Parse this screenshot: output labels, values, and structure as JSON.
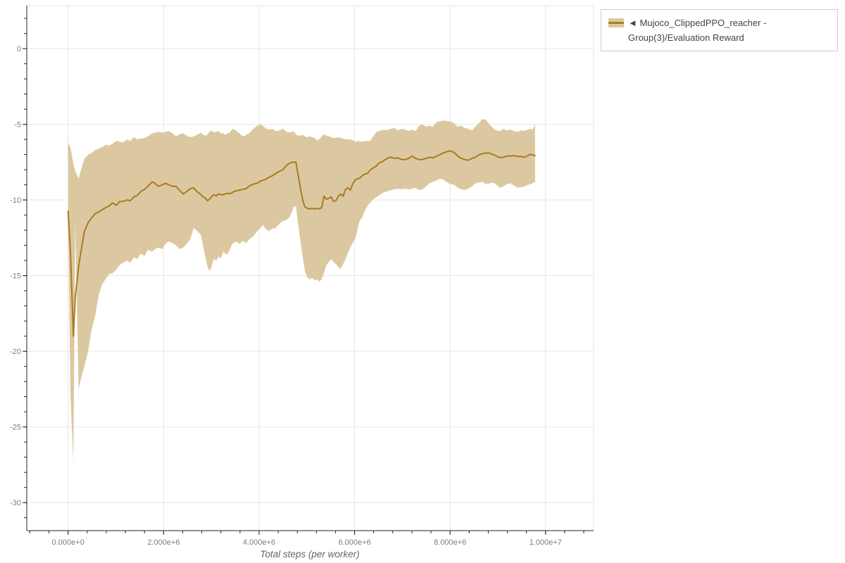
{
  "colors": {
    "background": "#ffffff",
    "line": "#a87b21",
    "band": "#dcc8a0",
    "grid": "#e5e5e5",
    "plot_outline": "#e5e5e5",
    "axis": "#262626",
    "tick_label": "#7d7d7d",
    "axis_title": "#666666",
    "legend_border": "#cccccc",
    "legend_text": "#444444"
  },
  "legend": {
    "items": [
      {
        "label": "◄ Mujoco_ClippedPPO_reacher - Group(3)/Evaluation Reward",
        "lines": [
          "◄ Mujoco_ClippedPPO_reacher - Group(3)/Evaluation",
          "Reward"
        ],
        "swatch_band_color": "#dcc8a0",
        "swatch_line_color": "#a87b21"
      }
    ]
  },
  "chart_data": {
    "type": "line",
    "title": "",
    "xlabel": "Total steps (per worker)",
    "ylabel": "",
    "grid": true,
    "legend_position": "top-right",
    "x_axis": {
      "min": -866000,
      "max": 11006000,
      "major_ticks": [
        {
          "value": 0,
          "label": "0.000e+0"
        },
        {
          "value": 2000000,
          "label": "2.000e+6"
        },
        {
          "value": 4000000,
          "label": "4.000e+6"
        },
        {
          "value": 6000000,
          "label": "6.000e+6"
        },
        {
          "value": 8000000,
          "label": "8.000e+6"
        },
        {
          "value": 10000000,
          "label": "1.000e+7"
        }
      ],
      "minor_tick_step": 400000
    },
    "y_axis": {
      "min": -31.85,
      "max": 2.84,
      "major_ticks": [
        {
          "value": 0,
          "label": "0"
        },
        {
          "value": -5,
          "label": "-5"
        },
        {
          "value": -10,
          "label": "-10"
        },
        {
          "value": -15,
          "label": "-15"
        },
        {
          "value": -20,
          "label": "-20"
        },
        {
          "value": -25,
          "label": "-25"
        },
        {
          "value": -30,
          "label": "-30"
        }
      ],
      "minor_tick_step": 1
    },
    "series": [
      {
        "name": "◄ Mujoco_ClippedPPO_reacher - Group(3)/Evaluation Reward",
        "line_color": "#a87b21",
        "band_color": "#dcc8a0",
        "point_format": [
          "x_steps",
          "mean",
          "band_low",
          "band_high"
        ],
        "points": [
          [
            0,
            -10.74,
            -11.0,
            -6.2
          ],
          [
            50000,
            -13.5,
            -23.0,
            -6.55
          ],
          [
            110000,
            -19.0,
            -27.3,
            -7.6
          ],
          [
            150000,
            -16.4,
            -11.5,
            -8.1
          ],
          [
            220000,
            -14.4,
            -22.5,
            -8.6
          ],
          [
            270000,
            -13.4,
            -21.8,
            -8.0
          ],
          [
            340000,
            -12.1,
            -21.0,
            -7.3
          ],
          [
            420000,
            -11.5,
            -20.0,
            -7.0
          ],
          [
            490000,
            -11.2,
            -18.6,
            -6.9
          ],
          [
            570000,
            -10.9,
            -17.6,
            -6.7
          ],
          [
            640000,
            -10.8,
            -16.3,
            -6.6
          ],
          [
            710000,
            -10.65,
            -15.6,
            -6.5
          ],
          [
            790000,
            -10.5,
            -15.2,
            -6.35
          ],
          [
            860000,
            -10.4,
            -14.9,
            -6.4
          ],
          [
            930000,
            -10.2,
            -14.85,
            -6.3
          ],
          [
            1010000,
            -10.35,
            -14.6,
            -6.1
          ],
          [
            1080000,
            -10.1,
            -14.3,
            -6.15
          ],
          [
            1150000,
            -10.1,
            -14.15,
            -6.2
          ],
          [
            1230000,
            -10.0,
            -14.0,
            -6.0
          ],
          [
            1300000,
            -10.05,
            -14.15,
            -6.1
          ],
          [
            1380000,
            -9.8,
            -13.8,
            -5.85
          ],
          [
            1450000,
            -9.7,
            -13.9,
            -6.0
          ],
          [
            1520000,
            -9.45,
            -13.55,
            -5.95
          ],
          [
            1600000,
            -9.3,
            -13.7,
            -5.9
          ],
          [
            1670000,
            -9.1,
            -13.3,
            -5.8
          ],
          [
            1760000,
            -8.8,
            -13.4,
            -5.6
          ],
          [
            1820000,
            -8.9,
            -13.25,
            -5.55
          ],
          [
            1890000,
            -9.1,
            -13.15,
            -5.5
          ],
          [
            1970000,
            -9.0,
            -13.25,
            -5.55
          ],
          [
            2040000,
            -8.9,
            -12.9,
            -5.5
          ],
          [
            2110000,
            -9.0,
            -12.75,
            -5.45
          ],
          [
            2190000,
            -9.1,
            -12.85,
            -5.6
          ],
          [
            2260000,
            -9.1,
            -13.0,
            -5.8
          ],
          [
            2330000,
            -9.35,
            -13.25,
            -5.65
          ],
          [
            2410000,
            -9.6,
            -13.15,
            -5.6
          ],
          [
            2480000,
            -9.45,
            -12.9,
            -5.75
          ],
          [
            2560000,
            -9.25,
            -12.6,
            -5.85
          ],
          [
            2630000,
            -9.2,
            -11.85,
            -5.8
          ],
          [
            2700000,
            -9.45,
            -12.05,
            -5.7
          ],
          [
            2780000,
            -9.65,
            -12.3,
            -5.55
          ],
          [
            2830000,
            -9.8,
            -13.1,
            -5.7
          ],
          [
            2880000,
            -9.9,
            -13.8,
            -5.75
          ],
          [
            2920000,
            -10.05,
            -14.4,
            -5.65
          ],
          [
            2960000,
            -9.95,
            -14.7,
            -5.5
          ],
          [
            3000000,
            -9.8,
            -14.45,
            -5.4
          ],
          [
            3050000,
            -9.65,
            -13.9,
            -5.55
          ],
          [
            3100000,
            -9.75,
            -14.0,
            -5.5
          ],
          [
            3150000,
            -9.6,
            -13.75,
            -5.45
          ],
          [
            3200000,
            -9.65,
            -13.85,
            -5.6
          ],
          [
            3250000,
            -9.65,
            -13.4,
            -5.6
          ],
          [
            3290000,
            -9.6,
            -13.55,
            -5.7
          ],
          [
            3340000,
            -9.55,
            -13.6,
            -5.6
          ],
          [
            3390000,
            -9.6,
            -13.25,
            -5.55
          ],
          [
            3440000,
            -9.5,
            -12.9,
            -5.3
          ],
          [
            3510000,
            -9.4,
            -12.75,
            -5.4
          ],
          [
            3590000,
            -9.35,
            -12.9,
            -5.6
          ],
          [
            3660000,
            -9.3,
            -12.7,
            -5.8
          ],
          [
            3730000,
            -9.25,
            -12.85,
            -5.7
          ],
          [
            3810000,
            -9.05,
            -12.55,
            -5.55
          ],
          [
            3880000,
            -8.95,
            -12.4,
            -5.3
          ],
          [
            3960000,
            -8.9,
            -12.05,
            -5.1
          ],
          [
            4030000,
            -8.75,
            -11.85,
            -5.0
          ],
          [
            4080000,
            -8.7,
            -11.65,
            -5.1
          ],
          [
            4130000,
            -8.65,
            -11.9,
            -5.25
          ],
          [
            4210000,
            -8.5,
            -12.05,
            -5.35
          ],
          [
            4280000,
            -8.4,
            -11.9,
            -5.3
          ],
          [
            4350000,
            -8.25,
            -11.85,
            -5.45
          ],
          [
            4430000,
            -8.1,
            -11.55,
            -5.4
          ],
          [
            4500000,
            -8.0,
            -11.4,
            -5.3
          ],
          [
            4580000,
            -7.7,
            -11.3,
            -5.5
          ],
          [
            4650000,
            -7.55,
            -11.1,
            -5.55
          ],
          [
            4720000,
            -7.5,
            -10.5,
            -5.45
          ],
          [
            4770000,
            -7.5,
            -10.4,
            -5.65
          ],
          [
            4820000,
            -8.4,
            -11.7,
            -5.75
          ],
          [
            4870000,
            -9.3,
            -12.8,
            -5.75
          ],
          [
            4920000,
            -10.1,
            -13.9,
            -5.7
          ],
          [
            4960000,
            -10.45,
            -14.7,
            -5.8
          ],
          [
            5010000,
            -10.55,
            -15.1,
            -5.85
          ],
          [
            5060000,
            -10.6,
            -15.25,
            -5.8
          ],
          [
            5110000,
            -10.55,
            -15.15,
            -5.85
          ],
          [
            5160000,
            -10.6,
            -15.3,
            -5.9
          ],
          [
            5210000,
            -10.55,
            -15.25,
            -6.05
          ],
          [
            5260000,
            -10.6,
            -15.4,
            -6.0
          ],
          [
            5310000,
            -10.5,
            -15.25,
            -5.8
          ],
          [
            5360000,
            -9.75,
            -14.8,
            -5.65
          ],
          [
            5410000,
            -9.95,
            -14.3,
            -5.75
          ],
          [
            5460000,
            -9.9,
            -14.1,
            -5.8
          ],
          [
            5510000,
            -9.8,
            -13.9,
            -5.85
          ],
          [
            5560000,
            -10.1,
            -14.1,
            -5.9
          ],
          [
            5610000,
            -10.05,
            -14.25,
            -5.9
          ],
          [
            5660000,
            -9.75,
            -14.45,
            -5.85
          ],
          [
            5710000,
            -9.6,
            -14.55,
            -5.9
          ],
          [
            5760000,
            -9.75,
            -14.25,
            -5.95
          ],
          [
            5810000,
            -9.3,
            -13.9,
            -6.0
          ],
          [
            5860000,
            -9.2,
            -13.5,
            -6.0
          ],
          [
            5910000,
            -9.35,
            -13.15,
            -6.0
          ],
          [
            5960000,
            -8.95,
            -12.85,
            -6.05
          ],
          [
            6020000,
            -8.65,
            -12.5,
            -6.15
          ],
          [
            6070000,
            -8.6,
            -11.8,
            -6.1
          ],
          [
            6110000,
            -8.55,
            -11.35,
            -6.15
          ],
          [
            6160000,
            -8.4,
            -11.15,
            -6.15
          ],
          [
            6210000,
            -8.3,
            -10.75,
            -6.1
          ],
          [
            6270000,
            -8.25,
            -10.4,
            -6.1
          ],
          [
            6320000,
            -8.05,
            -10.2,
            -6.1
          ],
          [
            6380000,
            -7.9,
            -10.0,
            -5.85
          ],
          [
            6460000,
            -7.75,
            -9.8,
            -5.5
          ],
          [
            6510000,
            -7.55,
            -9.7,
            -5.45
          ],
          [
            6560000,
            -7.5,
            -9.6,
            -5.4
          ],
          [
            6610000,
            -7.4,
            -9.5,
            -5.35
          ],
          [
            6660000,
            -7.3,
            -9.45,
            -5.4
          ],
          [
            6710000,
            -7.2,
            -9.4,
            -5.35
          ],
          [
            6760000,
            -7.18,
            -9.35,
            -5.3
          ],
          [
            6830000,
            -7.25,
            -9.3,
            -5.25
          ],
          [
            6910000,
            -7.22,
            -9.25,
            -5.4
          ],
          [
            6980000,
            -7.33,
            -9.3,
            -5.3
          ],
          [
            7060000,
            -7.33,
            -9.25,
            -5.35
          ],
          [
            7130000,
            -7.26,
            -9.3,
            -5.45
          ],
          [
            7210000,
            -7.1,
            -9.25,
            -5.35
          ],
          [
            7280000,
            -7.26,
            -9.2,
            -5.45
          ],
          [
            7350000,
            -7.33,
            -9.35,
            -5.1
          ],
          [
            7420000,
            -7.33,
            -9.3,
            -5.0
          ],
          [
            7500000,
            -7.25,
            -9.1,
            -5.15
          ],
          [
            7570000,
            -7.18,
            -8.9,
            -5.1
          ],
          [
            7640000,
            -7.22,
            -8.8,
            -5.15
          ],
          [
            7720000,
            -7.1,
            -8.7,
            -4.85
          ],
          [
            7790000,
            -7.0,
            -8.6,
            -4.8
          ],
          [
            7860000,
            -6.9,
            -8.65,
            -4.75
          ],
          [
            7940000,
            -6.8,
            -8.85,
            -4.8
          ],
          [
            8010000,
            -6.76,
            -8.95,
            -4.8
          ],
          [
            8090000,
            -6.87,
            -9.0,
            -4.95
          ],
          [
            8160000,
            -7.1,
            -9.2,
            -5.15
          ],
          [
            8230000,
            -7.25,
            -9.3,
            -5.1
          ],
          [
            8310000,
            -7.33,
            -9.35,
            -5.25
          ],
          [
            8380000,
            -7.38,
            -9.25,
            -5.3
          ],
          [
            8460000,
            -7.25,
            -9.1,
            -5.4
          ],
          [
            8530000,
            -7.18,
            -8.9,
            -5.15
          ],
          [
            8600000,
            -7.02,
            -8.85,
            -4.95
          ],
          [
            8670000,
            -6.95,
            -8.8,
            -4.65
          ],
          [
            8750000,
            -6.9,
            -8.95,
            -4.7
          ],
          [
            8820000,
            -6.9,
            -8.9,
            -5.0
          ],
          [
            8900000,
            -7.0,
            -8.85,
            -5.25
          ],
          [
            8970000,
            -7.1,
            -9.0,
            -5.4
          ],
          [
            9040000,
            -7.2,
            -9.2,
            -5.45
          ],
          [
            9120000,
            -7.18,
            -9.1,
            -5.3
          ],
          [
            9190000,
            -7.1,
            -8.95,
            -5.4
          ],
          [
            9260000,
            -7.1,
            -8.9,
            -5.35
          ],
          [
            9340000,
            -7.07,
            -9.05,
            -5.45
          ],
          [
            9410000,
            -7.13,
            -9.2,
            -5.5
          ],
          [
            9490000,
            -7.13,
            -9.15,
            -5.4
          ],
          [
            9560000,
            -7.18,
            -9.1,
            -5.45
          ],
          [
            9630000,
            -7.07,
            -9.0,
            -5.35
          ],
          [
            9680000,
            -6.98,
            -8.95,
            -5.3
          ],
          [
            9730000,
            -7.02,
            -8.9,
            -5.35
          ],
          [
            9780000,
            -7.07,
            -8.8,
            -5.0
          ]
        ]
      }
    ]
  }
}
